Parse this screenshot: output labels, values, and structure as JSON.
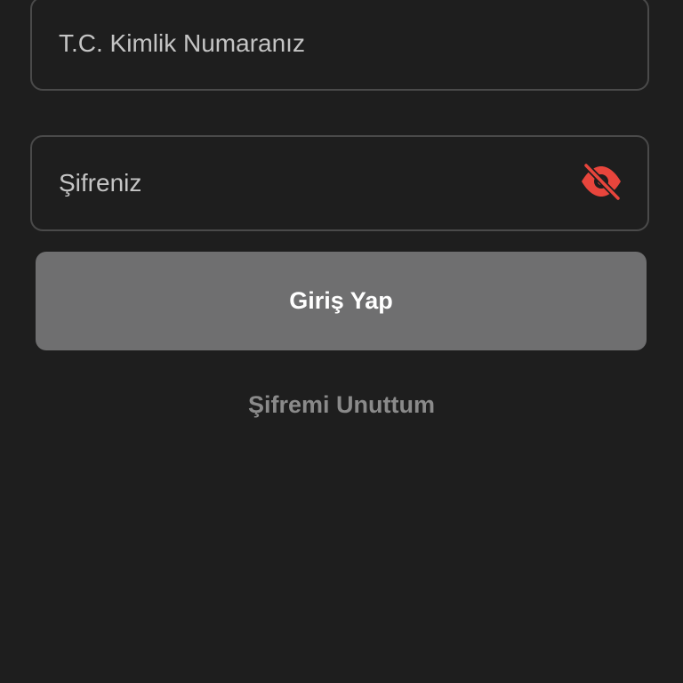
{
  "form": {
    "tc_placeholder": "T.C. Kimlik Numaranız",
    "password_placeholder": "Şifreniz",
    "password_toggle_icon": "eye-off-icon",
    "login_label": "Giriş Yap",
    "forgot_label": "Şifremi Unuttum"
  },
  "colors": {
    "background": "#1e1e1e",
    "field_border": "#4a4a4a",
    "button_bg": "#6f6f70",
    "accent_icon": "#e8453c",
    "link_text": "#8a8a8a"
  }
}
